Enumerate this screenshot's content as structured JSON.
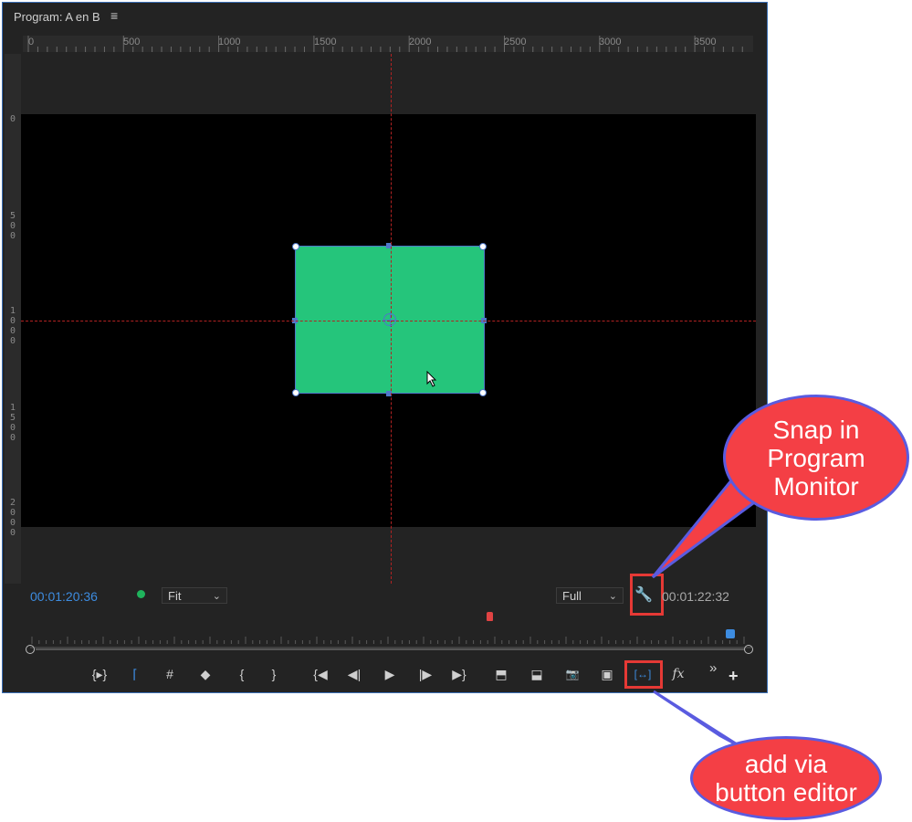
{
  "panel": {
    "title": "Program: A en B",
    "menu_icon": "hamburger-menu-icon"
  },
  "rulers": {
    "horizontal": [
      "0",
      "500",
      "1000",
      "1500",
      "2000",
      "2500",
      "3000",
      "3500"
    ],
    "vertical": [
      "0",
      "500",
      "1000",
      "1500",
      "2000"
    ]
  },
  "monitor": {
    "current_timecode": "00:01:20:36",
    "duration_timecode": "00:01:22:32",
    "zoom_level": "Fit",
    "resolution": "Full",
    "status_color": "#1fb35c",
    "rect_color": "#25c57b"
  },
  "toolbar": {
    "buttons": [
      {
        "icon": "lift-range-icon",
        "glyph": "{▸}"
      },
      {
        "icon": "safe-margins-icon",
        "glyph": "⌈"
      },
      {
        "icon": "grid-icon",
        "glyph": "#"
      },
      {
        "icon": "marker-icon",
        "glyph": "◆"
      },
      {
        "icon": "mark-in-icon",
        "glyph": "{"
      },
      {
        "icon": "mark-out-icon",
        "glyph": "}"
      },
      {
        "icon": "go-to-in-icon",
        "glyph": "{◀"
      },
      {
        "icon": "step-back-icon",
        "glyph": "◀|"
      },
      {
        "icon": "play-icon",
        "glyph": "▶"
      },
      {
        "icon": "step-forward-icon",
        "glyph": "|▶"
      },
      {
        "icon": "go-to-out-icon",
        "glyph": "▶}"
      },
      {
        "icon": "lift-icon",
        "glyph": "⬒"
      },
      {
        "icon": "extract-icon",
        "glyph": "⬓"
      },
      {
        "icon": "export-frame-icon",
        "glyph": "📷"
      },
      {
        "icon": "comparison-view-icon",
        "glyph": "▣"
      },
      {
        "icon": "snap-button-icon",
        "glyph": "[↔]"
      },
      {
        "icon": "fx-icon",
        "glyph": "fx"
      }
    ],
    "more_icon": "double-chevron-icon",
    "add_icon": "plus-icon"
  },
  "callouts": {
    "snap": "Snap in Program Monitor",
    "button_editor": "add via button editor"
  },
  "colors": {
    "callout_fill": "#f43f45",
    "callout_border": "#5a5be0",
    "highlight": "#e53935",
    "accent": "#3d8ce0"
  }
}
